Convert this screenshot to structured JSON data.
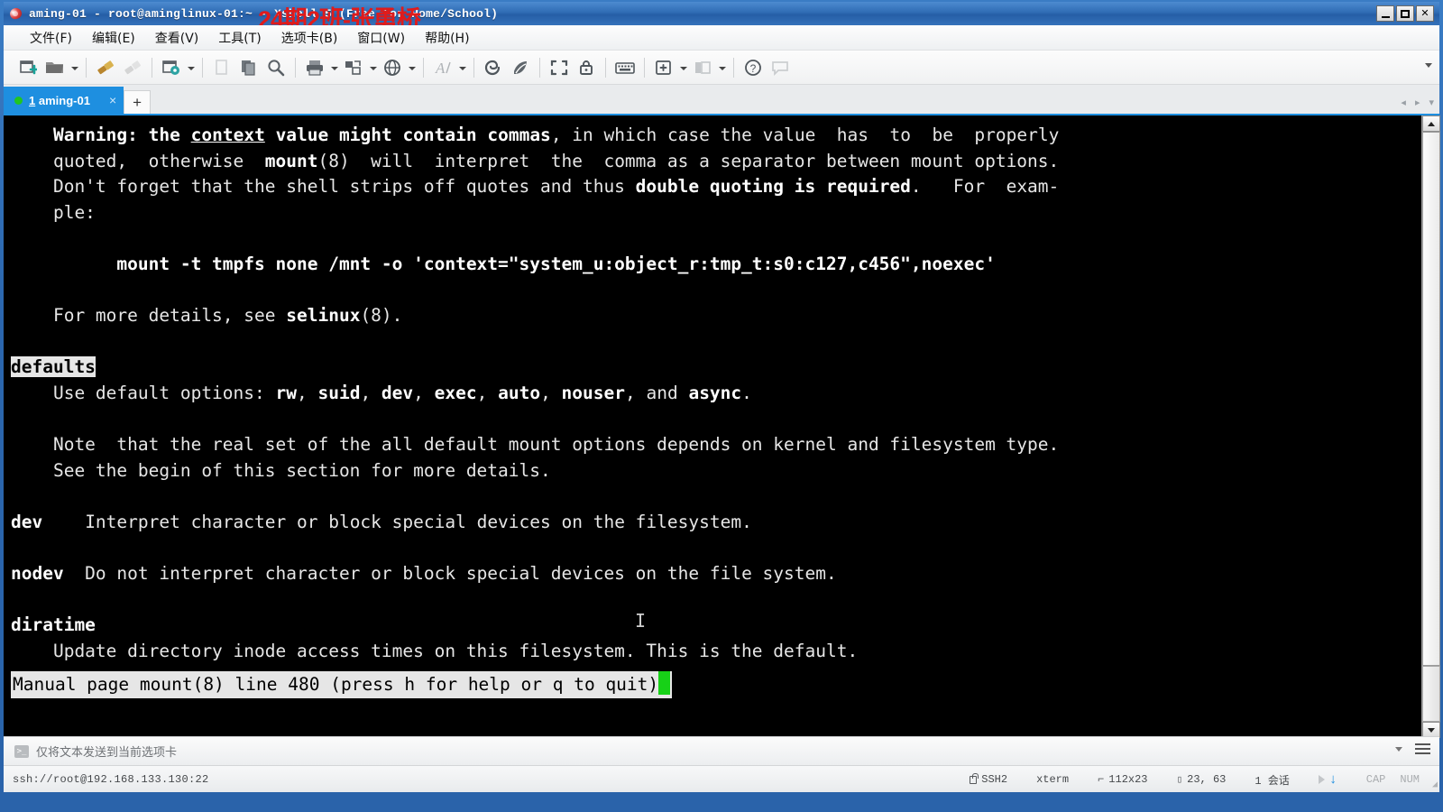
{
  "window": {
    "title": "aming-01 - root@aminglinux-01:~ - Xshell 5 (Free for Home/School)",
    "watermark": "24期2班-张勇桥",
    "minimize_label": "_",
    "maximize_label": "□",
    "close_label": "✕"
  },
  "menu": {
    "items": [
      {
        "label": "文件(F)",
        "name": "menu-file"
      },
      {
        "label": "编辑(E)",
        "name": "menu-edit"
      },
      {
        "label": "查看(V)",
        "name": "menu-view"
      },
      {
        "label": "工具(T)",
        "name": "menu-tools"
      },
      {
        "label": "选项卡(B)",
        "name": "menu-tabs"
      },
      {
        "label": "窗口(W)",
        "name": "menu-window"
      },
      {
        "label": "帮助(H)",
        "name": "menu-help"
      }
    ]
  },
  "toolbar": {
    "buttons": [
      "new-session-icon",
      "open-folder-icon",
      "folder-dropdown-arrow",
      "connect-icon",
      "disconnect-icon",
      "session-properties-icon",
      "properties-dropdown-arrow",
      "cut-icon",
      "copy-paste-icon",
      "find-icon",
      "print-icon",
      "print-dropdown-arrow",
      "transfer-icon",
      "transfer-dropdown-arrow",
      "web-icon",
      "web-dropdown-arrow",
      "font-icon",
      "font-dropdown-arrow",
      "xshell-icon",
      "xftp-icon",
      "fullscreen-icon",
      "lock-icon",
      "keyboard-icon",
      "add-tab-icon",
      "add-tab-dropdown-arrow",
      "layout-icon",
      "layout-dropdown-arrow",
      "help-icon",
      "comment-icon"
    ],
    "overflow_label": "▾"
  },
  "tabs": {
    "active": {
      "number": "1",
      "label": "aming-01",
      "close_label": "×"
    },
    "new_tab_label": "+",
    "nav_prev": "◂",
    "nav_next": "▸",
    "nav_menu": "▾"
  },
  "terminal": {
    "lines": [
      {
        "segments": [
          {
            "t": "    ",
            "s": "plain"
          },
          {
            "t": "Warning:",
            "s": "bold"
          },
          {
            "t": " ",
            "s": "plain"
          },
          {
            "t": "the",
            "s": "bold"
          },
          {
            "t": " ",
            "s": "plain"
          },
          {
            "t": "context",
            "s": "bold-underline"
          },
          {
            "t": " ",
            "s": "plain"
          },
          {
            "t": "value might contain commas",
            "s": "bold"
          },
          {
            "t": ", in which case the value  has  to  be  properly",
            "s": "plain"
          }
        ]
      },
      {
        "segments": [
          {
            "t": "    quoted,  otherwise  ",
            "s": "plain"
          },
          {
            "t": "mount",
            "s": "bold"
          },
          {
            "t": "(8)  will  interpret  the  comma as a separator between mount options.",
            "s": "plain"
          }
        ]
      },
      {
        "segments": [
          {
            "t": "    Don't forget that the shell strips off quotes and thus ",
            "s": "plain"
          },
          {
            "t": "double quoting is required",
            "s": "bold"
          },
          {
            "t": ".   For  exam-",
            "s": "plain"
          }
        ]
      },
      {
        "segments": [
          {
            "t": "    ple:",
            "s": "plain"
          }
        ]
      },
      {
        "segments": [
          {
            "t": "",
            "s": "plain"
          }
        ]
      },
      {
        "segments": [
          {
            "t": "          mount -t tmpfs none /mnt -o 'context=\"system_u:object_r:tmp_t:s0:c127,c456\",noexec'",
            "s": "bold"
          }
        ]
      },
      {
        "segments": [
          {
            "t": "",
            "s": "plain"
          }
        ]
      },
      {
        "segments": [
          {
            "t": "    For more details, see ",
            "s": "plain"
          },
          {
            "t": "selinux",
            "s": "bold"
          },
          {
            "t": "(8).",
            "s": "plain"
          }
        ]
      },
      {
        "segments": [
          {
            "t": "",
            "s": "plain"
          }
        ]
      },
      {
        "segments": [
          {
            "t": "defaults",
            "s": "inverse"
          }
        ]
      },
      {
        "segments": [
          {
            "t": "    Use default options: ",
            "s": "plain"
          },
          {
            "t": "rw",
            "s": "bold"
          },
          {
            "t": ", ",
            "s": "plain"
          },
          {
            "t": "suid",
            "s": "bold"
          },
          {
            "t": ", ",
            "s": "plain"
          },
          {
            "t": "dev",
            "s": "bold"
          },
          {
            "t": ", ",
            "s": "plain"
          },
          {
            "t": "exec",
            "s": "bold"
          },
          {
            "t": ", ",
            "s": "plain"
          },
          {
            "t": "auto",
            "s": "bold"
          },
          {
            "t": ", ",
            "s": "plain"
          },
          {
            "t": "nouser",
            "s": "bold"
          },
          {
            "t": ", and ",
            "s": "plain"
          },
          {
            "t": "async",
            "s": "bold"
          },
          {
            "t": ".",
            "s": "plain"
          }
        ]
      },
      {
        "segments": [
          {
            "t": "",
            "s": "plain"
          }
        ]
      },
      {
        "segments": [
          {
            "t": "    Note  that the real set of the all default mount options depends on kernel and filesystem type.",
            "s": "plain"
          }
        ]
      },
      {
        "segments": [
          {
            "t": "    See the begin of this section for more details.",
            "s": "plain"
          }
        ]
      },
      {
        "segments": [
          {
            "t": "",
            "s": "plain"
          }
        ]
      },
      {
        "segments": [
          {
            "t": "dev",
            "s": "bold"
          },
          {
            "t": "    Interpret character or block special devices on the filesystem.",
            "s": "plain"
          }
        ]
      },
      {
        "segments": [
          {
            "t": "",
            "s": "plain"
          }
        ]
      },
      {
        "segments": [
          {
            "t": "nodev",
            "s": "bold"
          },
          {
            "t": "  Do not interpret character or block special devices on the file system.",
            "s": "plain"
          }
        ]
      },
      {
        "segments": [
          {
            "t": "",
            "s": "plain"
          }
        ]
      },
      {
        "segments": [
          {
            "t": "diratime",
            "s": "bold"
          }
        ]
      },
      {
        "segments": [
          {
            "t": "    Update directory inode access times on this filesystem. This is the default.",
            "s": "plain"
          }
        ]
      }
    ],
    "status_line": "Manual page mount(8) line 480 (press h for help or q to quit)",
    "caret_glyph": "I"
  },
  "sendto": {
    "label": "仅将文本发送到当前选项卡",
    "icon_glyph": ">_"
  },
  "statusbar": {
    "url": "ssh://root@192.168.133.130:22",
    "protocol": "SSH2",
    "terminal_type": "xterm",
    "size": "112x23",
    "cursor_pos": "23, 63",
    "sessions": "1 会话",
    "caps": "CAP",
    "num": "NUM"
  },
  "colors": {
    "accent": "#1e8fe0",
    "titlebar": "#2f6cb4",
    "terminal_bg": "#000000",
    "terminal_fg": "#e6e6e6",
    "cursor_green": "#17d117",
    "watermark_red": "#e01b1b"
  }
}
